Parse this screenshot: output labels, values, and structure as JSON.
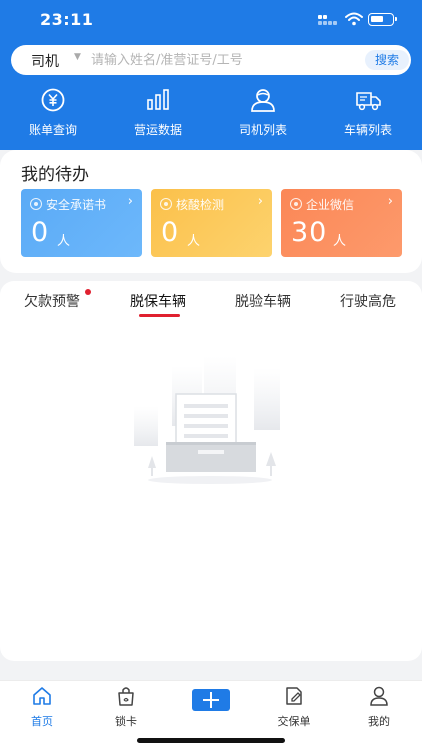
{
  "status": {
    "time": "23:11"
  },
  "search": {
    "role": "司机",
    "placeholder": "请输入姓名/准营证号/工号",
    "button": "搜索"
  },
  "quicknav": [
    {
      "label": "账单查询",
      "icon": "yen-circle-icon"
    },
    {
      "label": "营运数据",
      "icon": "bar-chart-icon"
    },
    {
      "label": "司机列表",
      "icon": "driver-icon"
    },
    {
      "label": "车辆列表",
      "icon": "truck-icon"
    }
  ],
  "todo": {
    "title": "我的待办",
    "items": [
      {
        "label": "安全承诺书",
        "count": "0",
        "unit": "人",
        "color": "#5aaaf6"
      },
      {
        "label": "核酸检测",
        "count": "0",
        "unit": "人",
        "color": "#fcc24e"
      },
      {
        "label": "企业微信",
        "count": "30",
        "unit": "人",
        "color": "#fb8959"
      }
    ]
  },
  "tabs": {
    "items": [
      "欠款预警",
      "脱保车辆",
      "脱验车辆",
      "行驶高危"
    ],
    "active": "脱保车辆"
  },
  "tabbar": {
    "items": [
      {
        "label": "首页",
        "icon": "home-icon",
        "active": true
      },
      {
        "label": "锁卡",
        "icon": "lock-bag-icon",
        "active": false
      },
      {
        "label": "",
        "icon": "plus-icon",
        "active": false
      },
      {
        "label": "交保单",
        "icon": "edit-doc-icon",
        "active": false
      },
      {
        "label": "我的",
        "icon": "user-icon",
        "active": false
      }
    ]
  },
  "colors": {
    "brand": "#1f7be6",
    "alert": "#e0202f"
  }
}
